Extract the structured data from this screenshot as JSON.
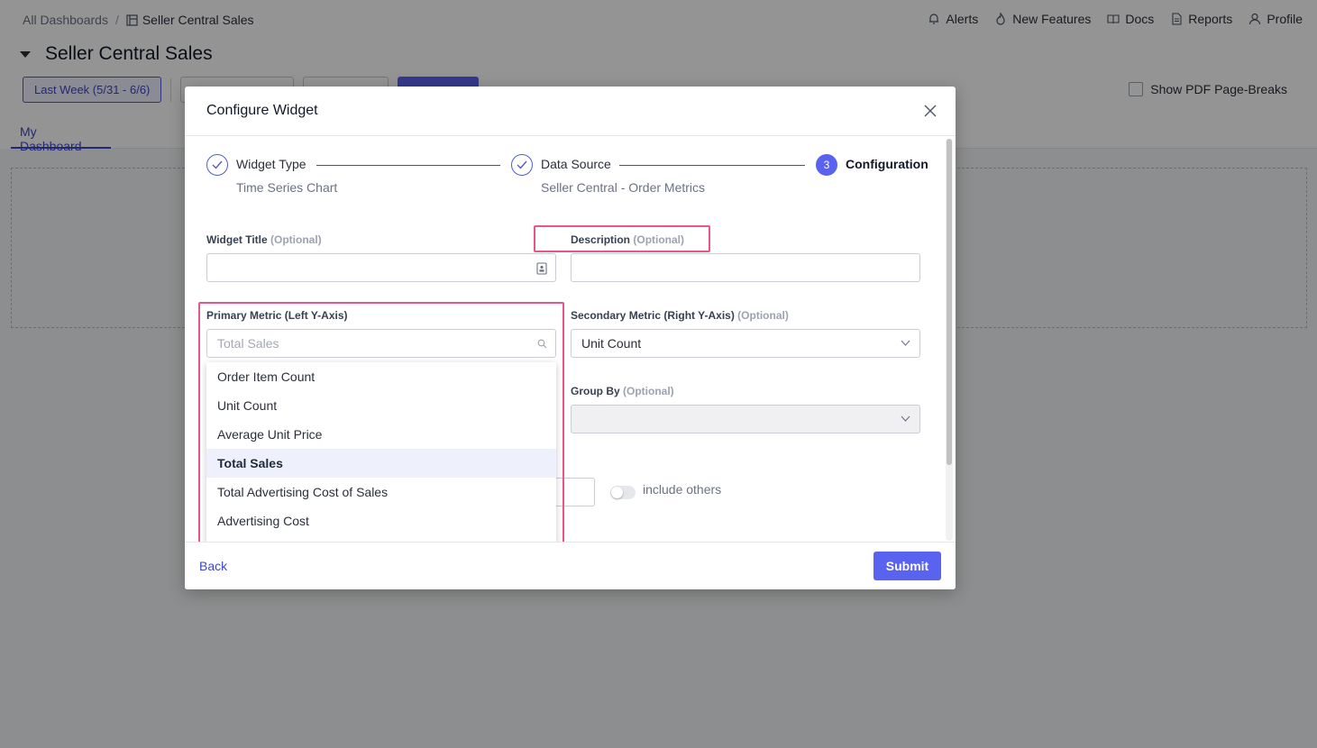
{
  "breadcrumb": {
    "root": "All Dashboards",
    "separator": "/",
    "current": "Seller Central Sales"
  },
  "topnav": [
    {
      "label": "Alerts",
      "icon": "bell-icon"
    },
    {
      "label": "New Features",
      "icon": "flame-icon"
    },
    {
      "label": "Docs",
      "icon": "book-icon"
    },
    {
      "label": "Reports",
      "icon": "document-icon"
    },
    {
      "label": "Profile",
      "icon": "user-icon"
    }
  ],
  "page": {
    "title": "Seller Central Sales",
    "date_range": "Last Week (5/31 - 6/6)",
    "pdf_breaks_label": "Show PDF Page-Breaks",
    "tab_label": "My Dashboard"
  },
  "modal": {
    "title": "Configure Widget",
    "steps": [
      {
        "label": "Widget Type",
        "sub": "Time Series Chart",
        "state": "done"
      },
      {
        "label": "Data Source",
        "sub": "Seller Central - Order Metrics",
        "state": "done"
      },
      {
        "label": "Configuration",
        "number": "3",
        "state": "active"
      }
    ],
    "widget_title": {
      "label": "Widget Title",
      "optional": "(Optional)",
      "value": ""
    },
    "description": {
      "label": "Description",
      "optional": "(Optional)",
      "value": ""
    },
    "primary_metric": {
      "label": "Primary Metric (Left Y-Axis)",
      "placeholder": "Total Sales",
      "options": [
        "Order Item Count",
        "Unit Count",
        "Average Unit Price",
        "Total Sales",
        "Total Advertising Cost of Sales",
        "Advertising Cost"
      ],
      "selected": "Total Sales"
    },
    "secondary_metric": {
      "label": "Secondary Metric (Right Y-Axis)",
      "optional": "(Optional)",
      "value": "Unit Count"
    },
    "group_by": {
      "label": "Group By",
      "optional": "(Optional)",
      "value": ""
    },
    "include_others_label": "include others",
    "back_label": "Back",
    "submit_label": "Submit"
  },
  "colors": {
    "accent": "#5a62f0",
    "highlight": "#e8558b",
    "link": "#3c48c4"
  }
}
